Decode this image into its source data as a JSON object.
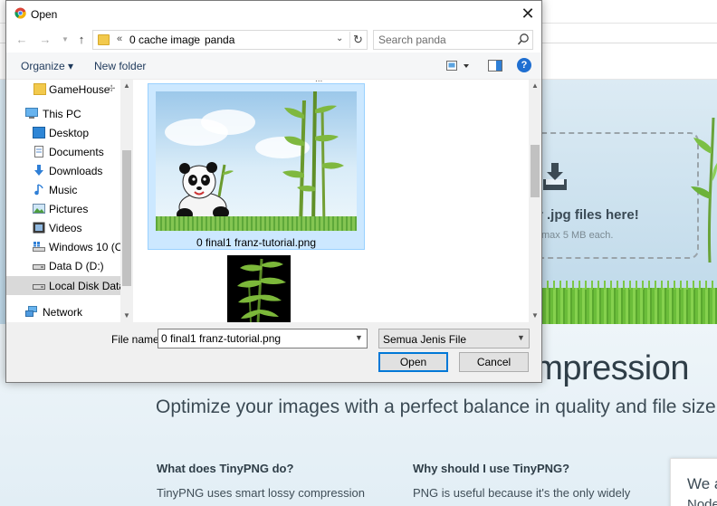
{
  "dialog": {
    "title": "Open",
    "address": {
      "sep0": "«",
      "crumbs": [
        "0 cache image",
        "panda"
      ]
    },
    "search": {
      "placeholder": "Search panda"
    },
    "toolbar": {
      "organize": "Organize ▾",
      "new_folder": "New folder"
    },
    "nav": {
      "items": [
        {
          "label": "GameHouse",
          "icon": "folder-icon",
          "pinned": true
        },
        {
          "label": "This PC",
          "icon": "computer-icon"
        },
        {
          "label": "Desktop",
          "icon": "desktop-icon"
        },
        {
          "label": "Documents",
          "icon": "documents-icon"
        },
        {
          "label": "Downloads",
          "icon": "download-icon"
        },
        {
          "label": "Music",
          "icon": "music-icon"
        },
        {
          "label": "Pictures",
          "icon": "pictures-icon"
        },
        {
          "label": "Videos",
          "icon": "videos-icon"
        },
        {
          "label": "Windows 10 (C:)",
          "icon": "drive-c-icon"
        },
        {
          "label": "Data D (D:)",
          "icon": "drive-icon"
        },
        {
          "label": "Local Disk Data (",
          "icon": "drive-icon",
          "selected": true
        },
        {
          "label": "Network",
          "icon": "network-icon"
        }
      ]
    },
    "files": [
      {
        "label": "0 final1 franz-tutorial.png",
        "selected": true
      },
      {
        "label": ""
      }
    ],
    "bottom": {
      "file_name_label": "File name:",
      "file_name_value": "0 final1 franz-tutorial.png",
      "file_type": "Semua Jenis File",
      "open_label": "Open",
      "cancel_label": "Cancel"
    }
  },
  "background": {
    "drop_title": "r .jpg files here!",
    "drop_sub": "max 5 MB each.",
    "hero_title": "Smart PNG and JPEG compression",
    "hero_sub": "Optimize your images with a perfect balance in quality and file size.",
    "col1_heading": "What does TinyPNG do?",
    "col1_text": "TinyPNG uses smart lossy compression",
    "col2_heading": "Why should I use TinyPNG?",
    "col2_text": "PNG is useful because it's the only widely",
    "side_line1": "We a",
    "side_line2": "Node"
  },
  "colors": {
    "accent": "#0078d7",
    "selection": "#cce8ff",
    "help": "#1f6fd1"
  }
}
